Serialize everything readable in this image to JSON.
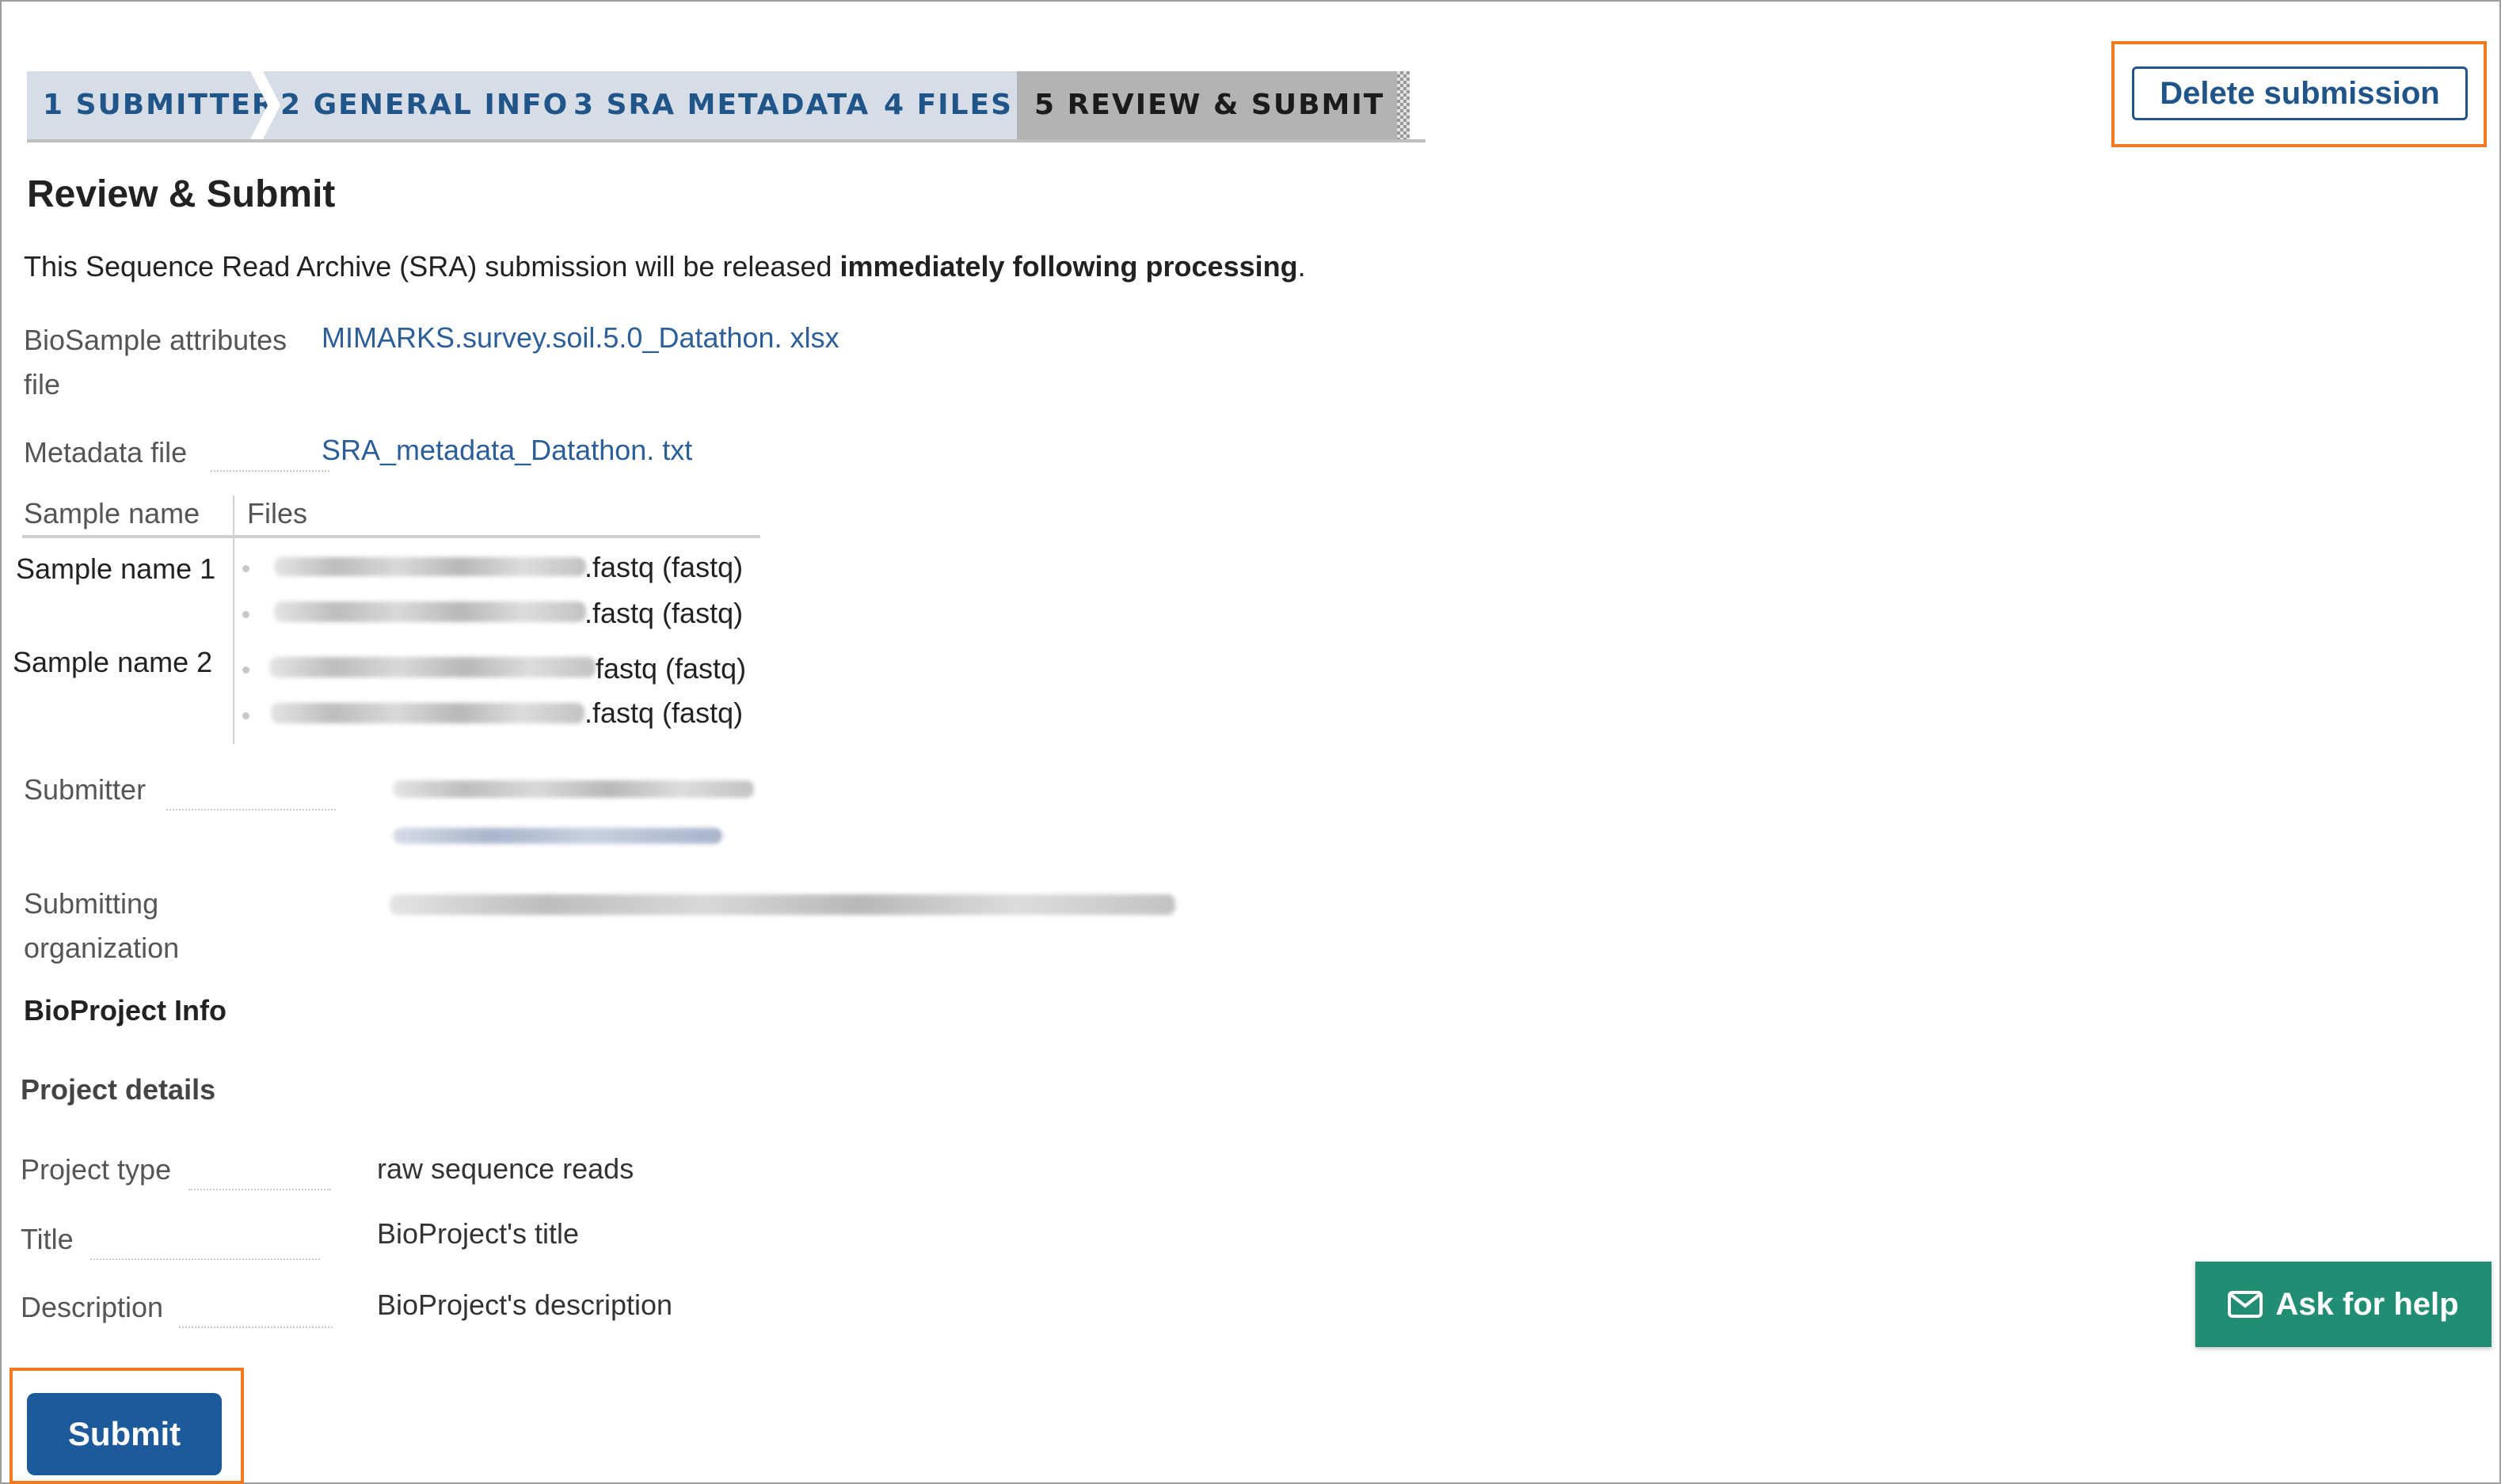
{
  "steps": [
    {
      "label": "1 SUBMITTER"
    },
    {
      "label": "2 GENERAL INFO"
    },
    {
      "label": "3 SRA METADATA"
    },
    {
      "label": "4 FILES"
    },
    {
      "label": "5 REVIEW & SUBMIT"
    }
  ],
  "delete_button": "Delete submission",
  "page_title": "Review & Submit",
  "intro": {
    "prefix": "This Sequence Read Archive (SRA) submission will be released ",
    "bold": "immediately following processing",
    "suffix": "."
  },
  "biosample": {
    "label_line1": "BioSample attributes",
    "label_line2": "file",
    "value": "MIMARKS.survey.soil.5.0_Datathon. xlsx"
  },
  "metadata_file": {
    "label": "Metadata file",
    "value": "SRA_metadata_Datathon. txt"
  },
  "files_table": {
    "header_sample": "Sample name",
    "header_files": "Files",
    "rows": [
      {
        "sample": "Sample name 1",
        "files": [
          ".fastq (fastq)",
          ".fastq (fastq)"
        ]
      },
      {
        "sample": "Sample name 2",
        "files": [
          "fastq (fastq)",
          ".fastq (fastq)"
        ]
      }
    ]
  },
  "submitter": {
    "label": "Submitter"
  },
  "organization": {
    "label_line1": "Submitting",
    "label_line2": "organization"
  },
  "bioproject_info": "BioProject Info",
  "project_details": {
    "heading": "Project details",
    "project_type_label": "Project type",
    "project_type_value": "raw sequence reads",
    "title_label": "Title",
    "title_value": "BioProject's title",
    "description_label": "Description",
    "description_value": "BioProject's description"
  },
  "help_button": "Ask for help",
  "submit_button": "Submit",
  "colors": {
    "accent": "#20558a",
    "highlight": "#f07a22",
    "help": "#218d73",
    "submit": "#1c5a9b"
  },
  "icons": {
    "help": "envelope-icon"
  }
}
